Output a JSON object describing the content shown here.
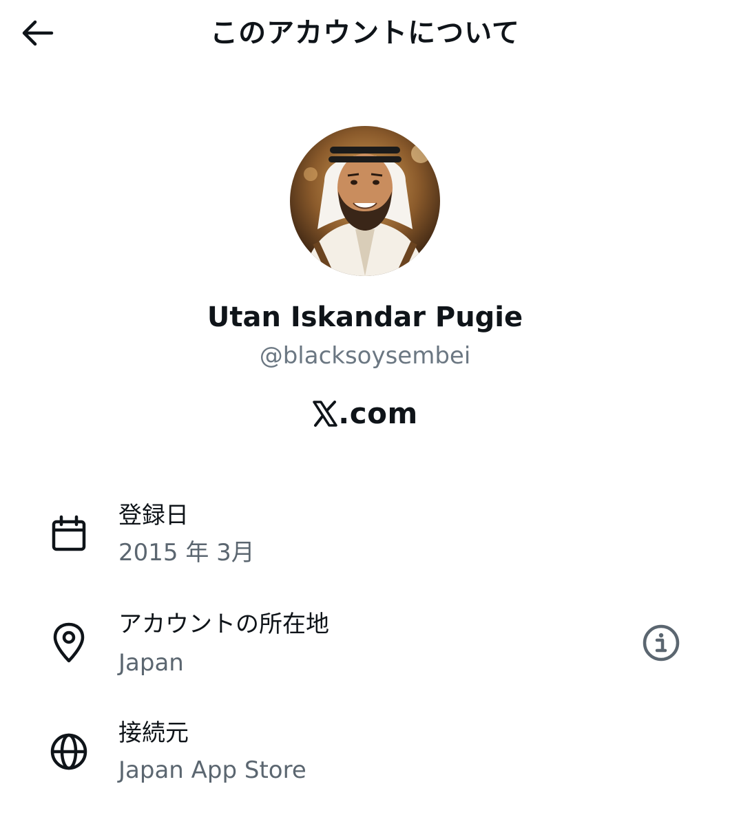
{
  "header": {
    "title": "このアカウントについて",
    "back_icon": "arrow-left-icon"
  },
  "profile": {
    "avatar_icon": "profile-photo",
    "display_name": "Utan Iskandar Pugie",
    "handle": "@blacksoysembei",
    "site_text": ".com",
    "site_logo": "x-logo-icon"
  },
  "rows": [
    {
      "icon": "calendar-icon",
      "label": "登録日",
      "value": "2015 年 3月"
    },
    {
      "icon": "location-pin-icon",
      "label": "アカウントの所在地",
      "value": "Japan",
      "trailing_icon": "info-icon"
    },
    {
      "icon": "globe-icon",
      "label": "接続元",
      "value": "Japan App Store"
    }
  ],
  "colors": {
    "text_primary": "#0f1419",
    "text_secondary": "#5b6670",
    "background": "#ffffff"
  }
}
